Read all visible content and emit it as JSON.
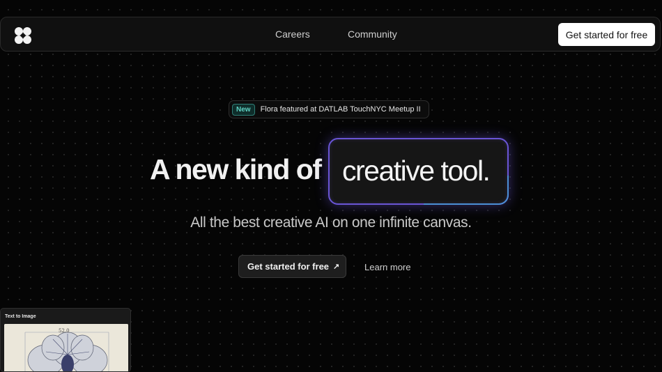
{
  "nav": {
    "links": [
      {
        "label": "Careers"
      },
      {
        "label": "Community"
      }
    ],
    "cta_label": "Get started for free"
  },
  "announcement": {
    "badge": "New",
    "text": "Flora featured at DATLAB TouchNYC Meetup II"
  },
  "hero": {
    "headline_part1": "A new kind of",
    "headline_part2": "creative tool.",
    "subheadline": "All the best creative AI on one infinite canvas.",
    "primary_cta": "Get started for free",
    "primary_cta_icon": "arrow-up-right-icon",
    "secondary_cta": "Learn more"
  },
  "preview_card": {
    "title": "Text to Image",
    "image_label": "52.0"
  },
  "colors": {
    "background": "#050505",
    "accent_purple": "#6a55d6",
    "accent_blue": "#4b8fd6",
    "badge_teal": "#5fd3c4"
  }
}
